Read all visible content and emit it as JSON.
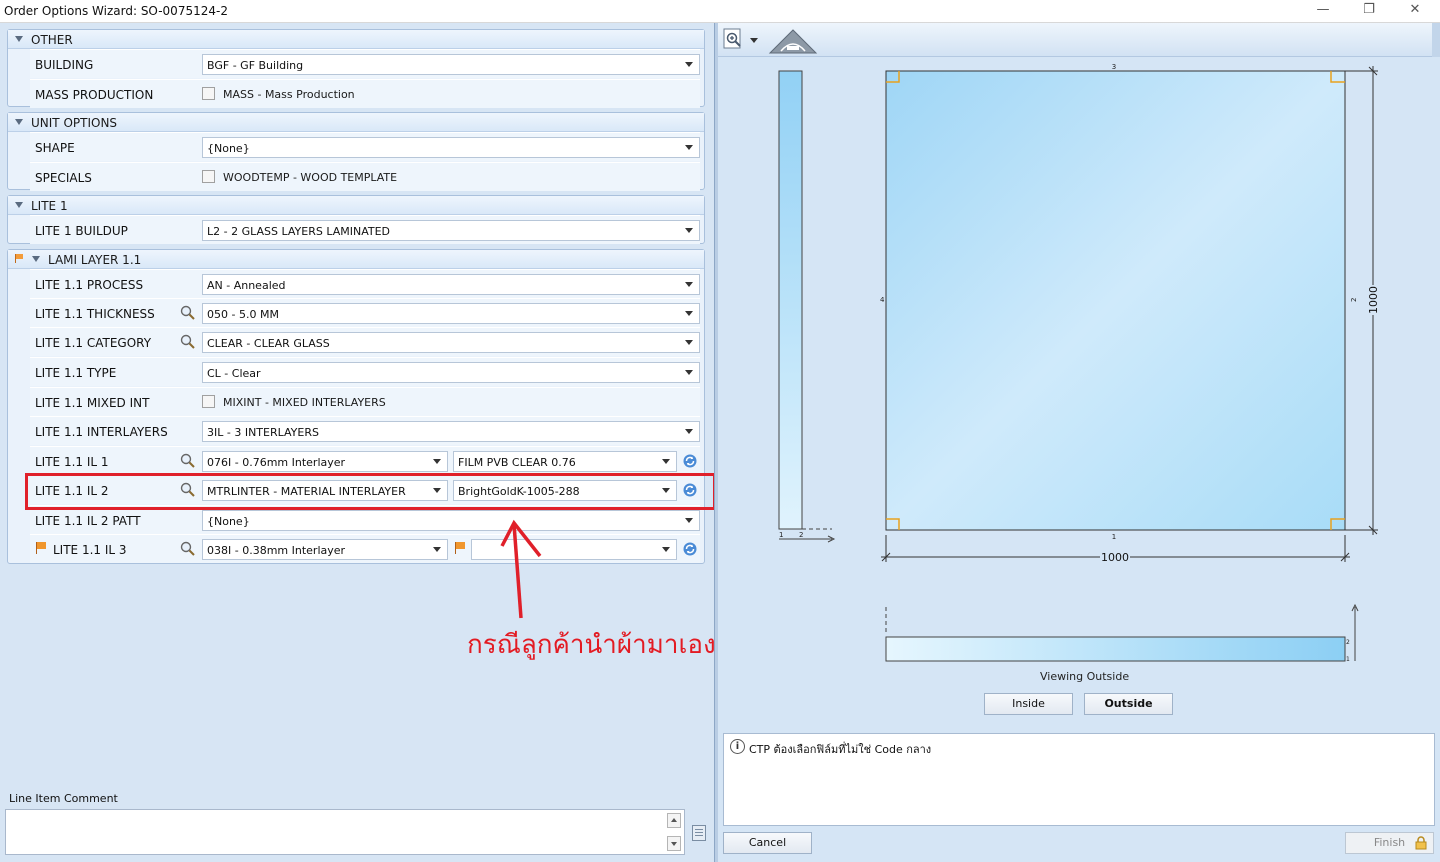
{
  "window": {
    "title": "Order Options Wizard: SO-0075124-2",
    "minimize": "—",
    "maximize": "❐",
    "close": "✕"
  },
  "groups": {
    "other": {
      "title": "OTHER",
      "building": {
        "label": "BUILDING",
        "value": "BGF - GF Building"
      },
      "mass_production": {
        "label": "MASS PRODUCTION",
        "option": "MASS - Mass Production",
        "checked": false
      }
    },
    "unit_options": {
      "title": "UNIT OPTIONS",
      "shape": {
        "label": "SHAPE",
        "value": "{None}"
      },
      "specials": {
        "label": "SPECIALS",
        "option": "WOODTEMP - WOOD TEMPLATE",
        "checked": false
      }
    },
    "lite1": {
      "title": "LITE 1",
      "buildup": {
        "label": "LITE 1 BUILDUP",
        "value": "L2 - 2 GLASS LAYERS LAMINATED"
      }
    },
    "lami": {
      "title": "LAMI LAYER 1.1",
      "process": {
        "label": "LITE 1.1 PROCESS",
        "value": "AN - Annealed"
      },
      "thickness": {
        "label": "LITE 1.1 THICKNESS",
        "value": "050 - 5.0 MM"
      },
      "category": {
        "label": "LITE 1.1 CATEGORY",
        "value": "CLEAR - CLEAR GLASS"
      },
      "type": {
        "label": "LITE 1.1 TYPE",
        "value": "CL - Clear"
      },
      "mixed_int": {
        "label": "LITE 1.1 MIXED INT",
        "option": "MIXINT - MIXED INTERLAYERS",
        "checked": false
      },
      "interlayers": {
        "label": "LITE 1.1 INTERLAYERS",
        "value": "3IL - 3 INTERLAYERS"
      },
      "il1": {
        "label": "LITE 1.1 IL 1",
        "value": "076I - 0.76mm Interlayer",
        "value2": "FILM PVB CLEAR 0.76"
      },
      "il2": {
        "label": "LITE 1.1 IL 2",
        "value": "MTRLINTER - MATERIAL INTERLAYER",
        "value2": "BrightGoldK-1005-288"
      },
      "il2_patt": {
        "label": "LITE 1.1 IL 2 PATT",
        "value": "{None}"
      },
      "il3": {
        "label": "LITE 1.1 IL 3",
        "value": "038I - 0.38mm Interlayer",
        "value2": ""
      }
    }
  },
  "annotation": {
    "text": "กรณีลูกค้านำผ้ามาเองใส่ CUSTOM",
    "color": "#e31b23"
  },
  "comment": {
    "label": "Line Item Comment",
    "value": ""
  },
  "preview": {
    "width_dim": "1000",
    "height_dim": "1000",
    "edge_top": "3",
    "edge_bottom": "1",
    "edge_left": "4",
    "edge_right": "2",
    "side_label_1": "1",
    "side_label_2": "2",
    "strip_label_1": "1",
    "strip_label_2": "2",
    "viewing_label": "Viewing Outside",
    "inside_button": "Inside",
    "outside_button": "Outside"
  },
  "info": {
    "message": "CTP ต้องเลือกฟิล์มที่ไม่ใช่ Code กลาง"
  },
  "footer": {
    "cancel": "Cancel",
    "finish": "Finish"
  }
}
